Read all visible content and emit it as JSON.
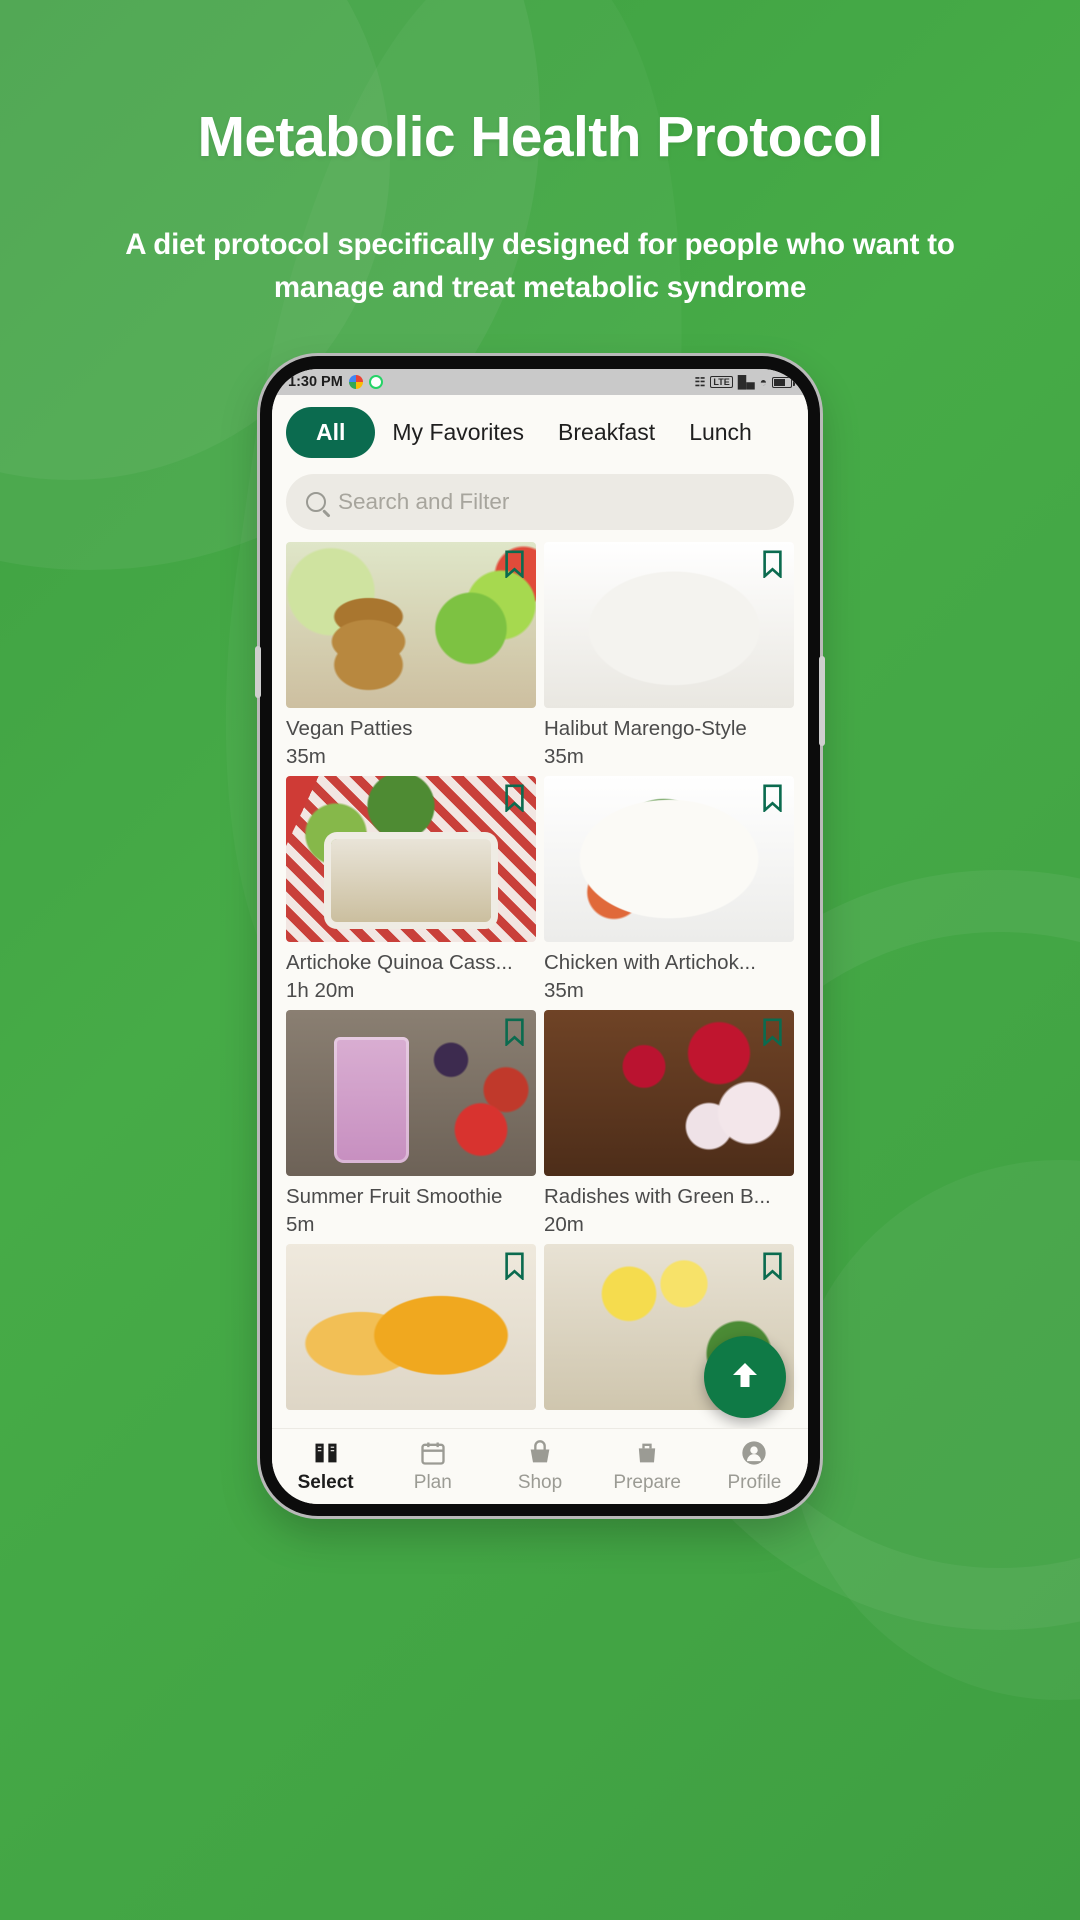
{
  "header": {
    "title": "Metabolic Health Protocol",
    "subtitle": "A diet protocol specifically designed for people who want to manage and treat metabolic syndrome"
  },
  "colors": {
    "background_green": "#3fa843",
    "accent_dark_green": "#0b6b4f",
    "fab_green": "#0f7a46",
    "card_text": "#4b4b4b",
    "placeholder": "#a7a59d"
  },
  "phone": {
    "status_bar": {
      "time": "1:30 PM",
      "left_icons": [
        "google-photos-icon",
        "whatsapp-icon"
      ],
      "right_icons": [
        "cast-icon",
        "lte-icon",
        "signal-icon",
        "wifi-icon",
        "battery-icon"
      ]
    },
    "tabs": [
      {
        "label": "All",
        "active": true
      },
      {
        "label": "My Favorites",
        "active": false
      },
      {
        "label": "Breakfast",
        "active": false
      },
      {
        "label": "Lunch",
        "active": false
      }
    ],
    "search": {
      "placeholder": "Search and Filter",
      "icon": "search-icon"
    },
    "recipes": [
      {
        "name": "Vegan Patties",
        "time": "35m",
        "bookmarked": false,
        "image": "img-patties"
      },
      {
        "name": "Halibut Marengo-Style",
        "time": "35m",
        "bookmarked": false,
        "image": "img-halibut"
      },
      {
        "name": "Artichoke Quinoa Cass...",
        "time": "1h 20m",
        "bookmarked": false,
        "image": "img-casserole"
      },
      {
        "name": "Chicken with Artichok...",
        "time": "35m",
        "bookmarked": false,
        "image": "img-chicken"
      },
      {
        "name": "Summer Fruit Smoothie",
        "time": "5m",
        "bookmarked": false,
        "image": "img-smoothie"
      },
      {
        "name": "Radishes with Green B...",
        "time": "20m",
        "bookmarked": false,
        "image": "img-radish"
      },
      {
        "name": "",
        "time": "",
        "bookmarked": false,
        "image": "img-squash"
      },
      {
        "name": "",
        "time": "",
        "bookmarked": false,
        "image": "img-lemon"
      }
    ],
    "fab": {
      "icon": "arrow-up-icon",
      "label": "Scroll to top"
    },
    "bottom_nav": [
      {
        "label": "Select",
        "icon": "book-icon",
        "active": true
      },
      {
        "label": "Plan",
        "icon": "calendar-icon",
        "active": false
      },
      {
        "label": "Shop",
        "icon": "basket-icon",
        "active": false
      },
      {
        "label": "Prepare",
        "icon": "bag-icon",
        "active": false
      },
      {
        "label": "Profile",
        "icon": "person-icon",
        "active": false
      }
    ]
  }
}
